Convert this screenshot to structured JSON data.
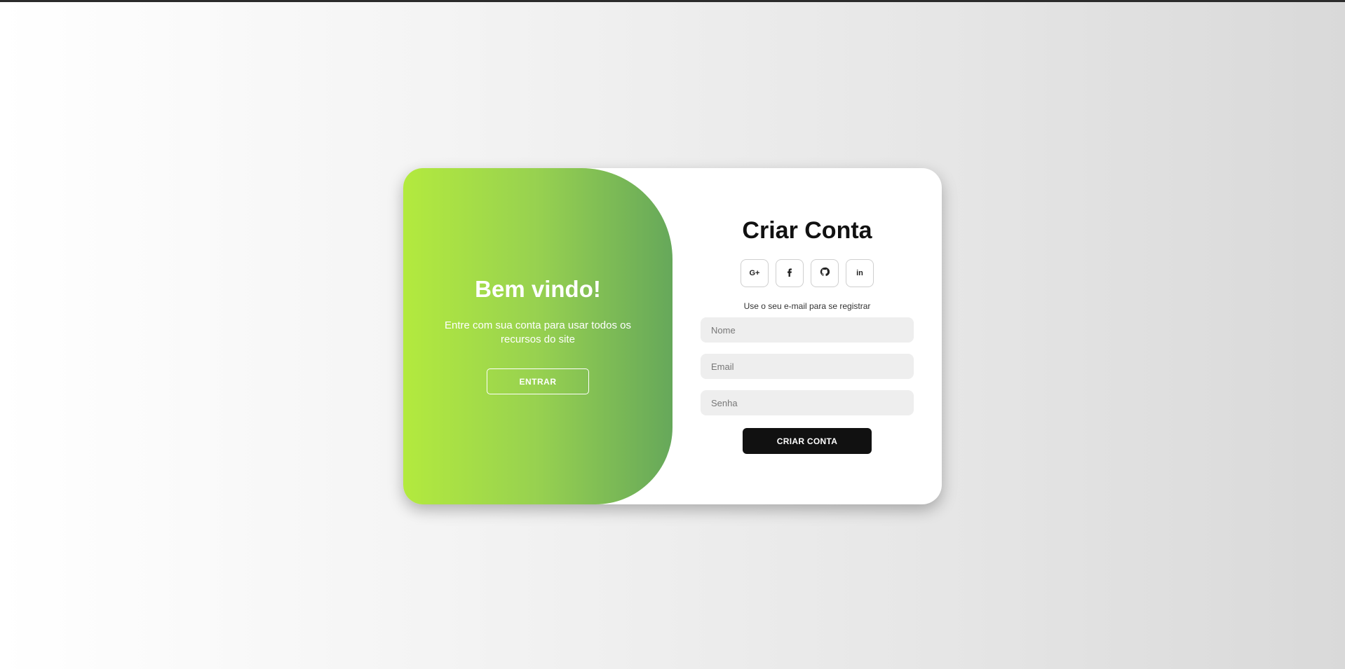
{
  "welcome": {
    "title": "Bem vindo!",
    "text": "Entre com sua conta para usar todos os recursos do site",
    "login_button": "ENTRAR"
  },
  "register": {
    "title": "Criar Conta",
    "social": [
      {
        "name": "google-plus-icon",
        "label": "G+"
      },
      {
        "name": "facebook-icon",
        "label": ""
      },
      {
        "name": "github-icon",
        "label": ""
      },
      {
        "name": "linkedin-icon",
        "label": "in"
      }
    ],
    "hint": "Use o seu e-mail para se registrar",
    "name_placeholder": "Nome",
    "email_placeholder": "Email",
    "password_placeholder": "Senha",
    "submit_button": "CRIAR CONTA"
  },
  "colors": {
    "gradient_start": "#b3ea3e",
    "gradient_end": "#66a85a",
    "dark_button": "#111111"
  }
}
